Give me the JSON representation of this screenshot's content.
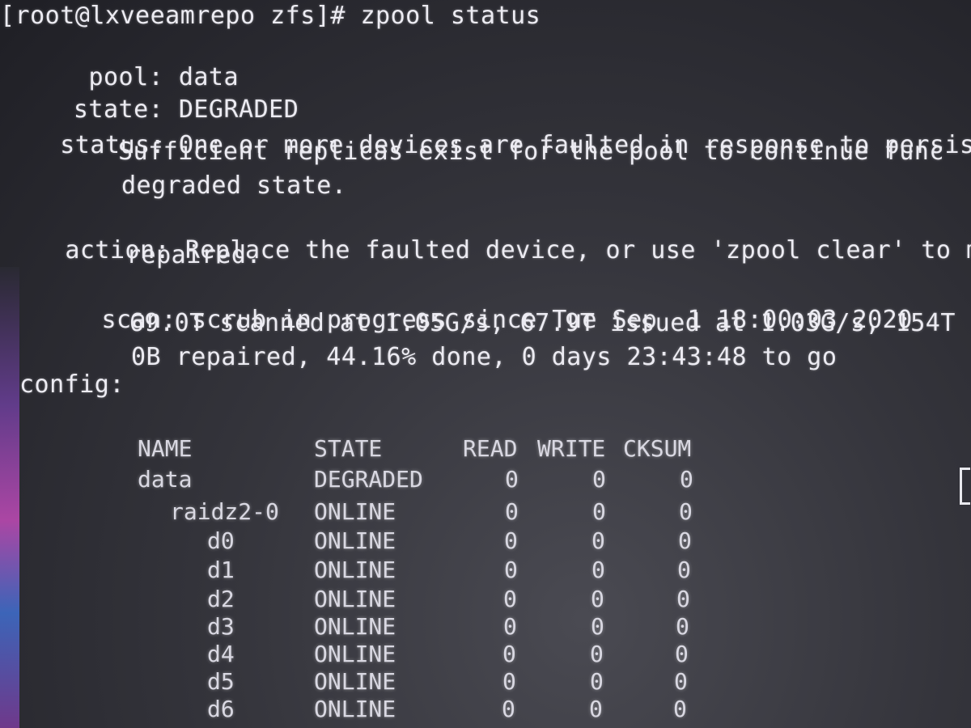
{
  "terminal": {
    "prompt": "[root@lxveeamrepo zfs]# zpool status",
    "pool": {
      "key": "pool:",
      "value": "data"
    },
    "state": {
      "key": "state:",
      "value": "DEGRADED"
    },
    "status": {
      "key": "status:",
      "lines": [
        "One or more devices are faulted in response to persiste",
        "Sufficient replicas exist for the pool to continue func",
        "degraded state."
      ]
    },
    "action": {
      "key": "action:",
      "lines": [
        "Replace the faulted device, or use 'zpool clear' to mar",
        "repaired."
      ]
    },
    "scan": {
      "key": "scan:",
      "lines": [
        "scrub in progress since Tue Sep  1 18:00:03 2020",
        "69.0T scanned at 1.05G/s, 67.9T issued at 1.03G/s, 154T",
        "0B repaired, 44.16% done, 0 days 23:43:48 to go"
      ]
    },
    "config": {
      "key": "config:"
    }
  },
  "config_table": {
    "headers": [
      "NAME",
      "STATE",
      "READ",
      "WRITE",
      "CKSUM"
    ],
    "rows": [
      {
        "name": "data",
        "state": "DEGRADED",
        "read": "0",
        "write": "0",
        "cksum": "0"
      },
      {
        "name": "raidz2-0",
        "state": "ONLINE",
        "read": "0",
        "write": "0",
        "cksum": "0"
      },
      {
        "name": "d0",
        "state": "ONLINE",
        "read": "0",
        "write": "0",
        "cksum": "0"
      },
      {
        "name": "d1",
        "state": "ONLINE",
        "read": "0",
        "write": "0",
        "cksum": "0"
      },
      {
        "name": "d2",
        "state": "ONLINE",
        "read": "0",
        "write": "0",
        "cksum": "0"
      },
      {
        "name": "d3",
        "state": "ONLINE",
        "read": "0",
        "write": "0",
        "cksum": "0"
      },
      {
        "name": "d4",
        "state": "ONLINE",
        "read": "0",
        "write": "0",
        "cksum": "0"
      },
      {
        "name": "d5",
        "state": "ONLINE",
        "read": "0",
        "write": "0",
        "cksum": "0"
      },
      {
        "name": "d6",
        "state": "ONLINE",
        "read": "0",
        "write": "0",
        "cksum": "0"
      }
    ]
  }
}
